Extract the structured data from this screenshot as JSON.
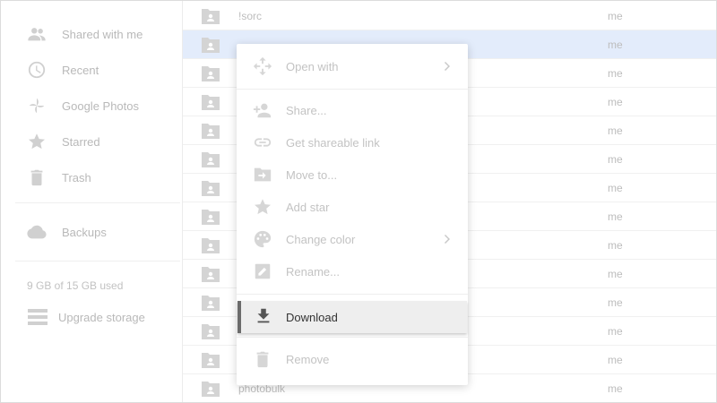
{
  "sidebar": {
    "items": [
      {
        "label": "Shared with me",
        "icon": "people-icon"
      },
      {
        "label": "Recent",
        "icon": "clock-icon"
      },
      {
        "label": "Google Photos",
        "icon": "pinwheel-icon"
      },
      {
        "label": "Starred",
        "icon": "star-icon"
      },
      {
        "label": "Trash",
        "icon": "trash-icon"
      },
      {
        "label": "Backups",
        "icon": "cloud-icon"
      }
    ],
    "storage_text": "9 GB of 15 GB used",
    "upgrade_label": "Upgrade storage"
  },
  "files": {
    "rows": [
      {
        "name": "!sorc",
        "owner": "me"
      },
      {
        "name": "",
        "owner": "me"
      },
      {
        "name": "",
        "owner": "me"
      },
      {
        "name": "",
        "owner": "me"
      },
      {
        "name": "",
        "owner": "me"
      },
      {
        "name": "",
        "owner": "me"
      },
      {
        "name": "",
        "owner": "me"
      },
      {
        "name": "",
        "owner": "me"
      },
      {
        "name": "",
        "owner": "me"
      },
      {
        "name": "",
        "owner": "me"
      },
      {
        "name": "",
        "owner": "me"
      },
      {
        "name": "",
        "owner": "me"
      },
      {
        "name": "",
        "owner": "me"
      },
      {
        "name": "photobulk",
        "owner": "me"
      }
    ]
  },
  "context_menu": {
    "items": {
      "open_with": "Open with",
      "share": "Share...",
      "get_link": "Get shareable link",
      "move_to": "Move to...",
      "add_star": "Add star",
      "change_color": "Change color",
      "rename": "Rename...",
      "download": "Download",
      "remove": "Remove"
    }
  },
  "colors": {
    "selected_row": "#e3ecfb",
    "menu_highlight": "#eeeeee",
    "highlight_bar": "#6b6b6b"
  }
}
